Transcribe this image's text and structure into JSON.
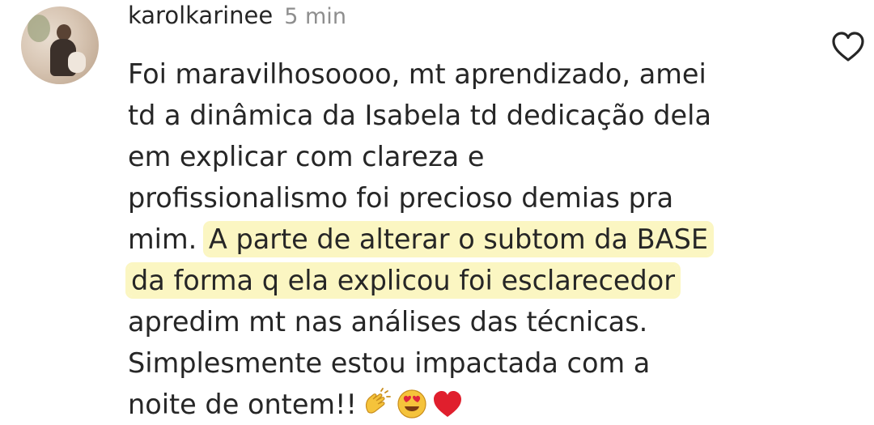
{
  "comment": {
    "username": "karolkarinee",
    "timestamp": "5 min",
    "lines": [
      "Foi maravilhosoooo, mt aprendizado, amei",
      "td a dinâmica da Isabela td dedicação dela",
      "em explicar com clareza e",
      "profissionalismo foi precioso demias pra",
      "mim. ",
      "apredim mt nas análises das técnicas.",
      "Simplesmente estou impactada com a",
      "noite de ontem!!"
    ],
    "highlighted": [
      "A parte de alterar o subtom da BASE",
      "da forma q ela explicou foi esclarecedor"
    ],
    "emojis": [
      "clapping-hands",
      "heart-eyes",
      "red-heart"
    ],
    "like_icon": "heart-outline-icon",
    "highlight_color": "#fbf6c2"
  }
}
